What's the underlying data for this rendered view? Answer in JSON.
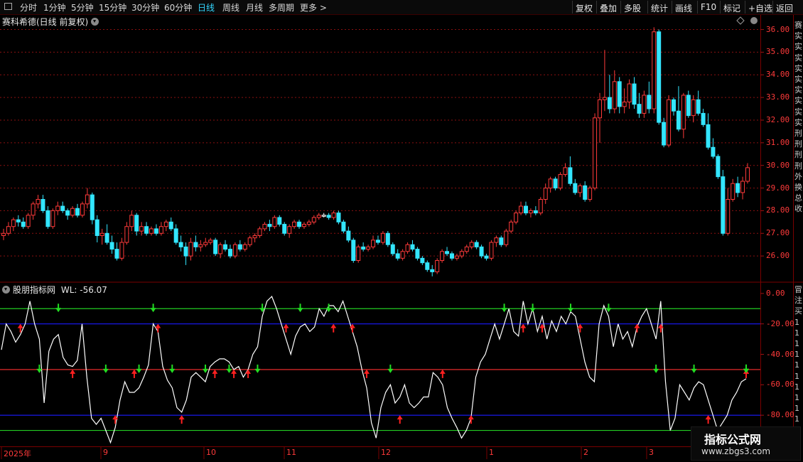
{
  "toolbar": {
    "periods": [
      "分时",
      "1分钟",
      "5分钟",
      "15分钟",
      "30分钟",
      "60分钟",
      "日线",
      "周线",
      "月线",
      "多周期",
      "更多 >"
    ],
    "active_period": "日线",
    "right_buttons": [
      "复权",
      "叠加",
      "多股",
      "统计",
      "画线",
      "F10",
      "标记",
      "+自选",
      "返回"
    ]
  },
  "stock": {
    "title": "赛科希德(日线 前复权)"
  },
  "indicator": {
    "name": "股朋指标网",
    "readout": "WL: -56.07"
  },
  "price_axis": {
    "labels": [
      "36.00",
      "35.00",
      "34.00",
      "33.00",
      "32.00",
      "31.00",
      "30.00",
      "29.00",
      "28.00",
      "27.00",
      "26.00"
    ]
  },
  "indicator_axis": {
    "labels": [
      "0.00",
      "-20.00",
      "-40.00",
      "-60.00",
      "-80.00"
    ]
  },
  "date_axis": {
    "labels": [
      "2025年",
      "9",
      "10",
      "11",
      "12",
      "1",
      "2",
      "3"
    ]
  },
  "right_edge_text": "赛\n实\n实\n实\n实\n实\n实\n实\n实\n实\n刑\n刑\n刑\n刑\n外\n换\n总\n收",
  "right_edge_text2": "冒\n注\n买\n1\n1\n1\n1\n1\n1\n1\n1\n1\n1\n1",
  "watermark": {
    "line1": "指标公式网",
    "line2": "www.zbgs3.com"
  },
  "colors": {
    "up": "#ff3a3a",
    "down": "#33e6ff",
    "flat": "#ffffff",
    "line": "#ffffff",
    "green_level": "#22cc22",
    "blue_level": "#1a1aff",
    "red_level": "#ff3030"
  },
  "chart_data": [
    {
      "type": "candlestick",
      "title": "赛科希德(日线 前复权)",
      "ylim": [
        25.0,
        36.3
      ],
      "yticks": [
        26,
        27,
        28,
        29,
        30,
        31,
        32,
        33,
        34,
        35,
        36
      ],
      "x_periods": [
        "2025年",
        "9",
        "10",
        "11",
        "12",
        "1",
        "2",
        "3"
      ],
      "candles": [
        [
          26.9,
          27.2,
          26.7,
          27.0
        ],
        [
          27.0,
          27.5,
          26.9,
          27.3
        ],
        [
          27.3,
          27.7,
          27.1,
          27.6
        ],
        [
          27.6,
          27.8,
          27.3,
          27.5
        ],
        [
          27.5,
          27.7,
          27.2,
          27.3
        ],
        [
          27.3,
          27.9,
          27.2,
          27.8
        ],
        [
          27.8,
          28.4,
          27.6,
          28.3
        ],
        [
          28.3,
          28.7,
          28.1,
          28.5
        ],
        [
          28.5,
          28.7,
          27.9,
          28.0
        ],
        [
          28.0,
          28.2,
          27.2,
          27.3
        ],
        [
          27.3,
          28.1,
          27.2,
          28.0
        ],
        [
          28.0,
          28.4,
          27.8,
          28.2
        ],
        [
          28.2,
          28.4,
          27.9,
          28.0
        ],
        [
          28.0,
          28.1,
          27.6,
          27.8
        ],
        [
          27.8,
          28.2,
          27.7,
          28.1
        ],
        [
          28.1,
          28.3,
          27.7,
          27.8
        ],
        [
          27.8,
          28.4,
          27.7,
          28.3
        ],
        [
          28.3,
          29.0,
          28.1,
          28.7
        ],
        [
          28.7,
          28.8,
          27.4,
          27.6
        ],
        [
          27.6,
          27.8,
          26.6,
          26.9
        ],
        [
          26.9,
          27.2,
          26.5,
          27.0
        ],
        [
          27.0,
          27.4,
          26.5,
          26.6
        ],
        [
          26.6,
          26.9,
          26.1,
          26.3
        ],
        [
          26.3,
          26.6,
          25.8,
          25.9
        ],
        [
          25.9,
          26.8,
          25.8,
          26.6
        ],
        [
          26.6,
          27.5,
          26.5,
          27.3
        ],
        [
          27.3,
          28.0,
          27.1,
          27.8
        ],
        [
          27.8,
          27.9,
          26.9,
          27.1
        ],
        [
          27.1,
          27.5,
          26.9,
          27.3
        ],
        [
          27.3,
          27.5,
          26.9,
          27.0
        ],
        [
          27.0,
          27.3,
          26.9,
          27.2
        ],
        [
          27.2,
          27.4,
          26.9,
          27.0
        ],
        [
          27.0,
          27.5,
          26.9,
          27.3
        ],
        [
          27.3,
          27.6,
          27.1,
          27.5
        ],
        [
          27.5,
          27.7,
          27.1,
          27.2
        ],
        [
          27.2,
          27.4,
          26.5,
          26.6
        ],
        [
          26.6,
          26.9,
          26.2,
          26.4
        ],
        [
          26.4,
          26.6,
          25.6,
          26.0
        ],
        [
          26.0,
          26.8,
          25.8,
          26.6
        ],
        [
          26.6,
          26.9,
          26.2,
          26.4
        ],
        [
          26.4,
          26.7,
          26.2,
          26.5
        ],
        [
          26.5,
          26.8,
          26.4,
          26.6
        ],
        [
          26.6,
          26.8,
          26.5,
          26.7
        ],
        [
          26.7,
          26.8,
          26.0,
          26.1
        ],
        [
          26.1,
          26.6,
          25.9,
          26.5
        ],
        [
          26.5,
          26.7,
          26.2,
          26.3
        ],
        [
          26.3,
          26.5,
          25.9,
          26.0
        ],
        [
          26.0,
          26.6,
          25.9,
          26.5
        ],
        [
          26.5,
          26.7,
          26.2,
          26.3
        ],
        [
          26.3,
          26.6,
          26.2,
          26.5
        ],
        [
          26.5,
          26.9,
          26.4,
          26.8
        ],
        [
          26.8,
          27.0,
          26.6,
          26.9
        ],
        [
          26.9,
          27.3,
          26.8,
          27.2
        ],
        [
          27.2,
          27.5,
          27.1,
          27.4
        ],
        [
          27.4,
          27.6,
          27.1,
          27.3
        ],
        [
          27.3,
          27.8,
          27.2,
          27.7
        ],
        [
          27.7,
          27.8,
          27.3,
          27.4
        ],
        [
          27.4,
          27.5,
          26.9,
          27.0
        ],
        [
          27.0,
          27.4,
          26.8,
          27.3
        ],
        [
          27.3,
          27.6,
          27.2,
          27.5
        ],
        [
          27.5,
          27.6,
          27.2,
          27.3
        ],
        [
          27.3,
          27.5,
          27.2,
          27.4
        ],
        [
          27.4,
          27.6,
          27.3,
          27.5
        ],
        [
          27.5,
          27.8,
          27.4,
          27.7
        ],
        [
          27.7,
          27.9,
          27.6,
          27.8
        ],
        [
          27.8,
          27.9,
          27.7,
          27.8
        ],
        [
          27.8,
          27.9,
          27.6,
          27.7
        ],
        [
          27.7,
          28.0,
          27.6,
          27.9
        ],
        [
          27.9,
          28.0,
          27.4,
          27.5
        ],
        [
          27.5,
          27.6,
          27.0,
          27.1
        ],
        [
          27.1,
          27.3,
          26.6,
          26.7
        ],
        [
          26.7,
          26.8,
          25.7,
          25.8
        ],
        [
          25.8,
          26.5,
          25.7,
          26.4
        ],
        [
          26.4,
          26.6,
          26.2,
          26.3
        ],
        [
          26.3,
          26.5,
          26.2,
          26.4
        ],
        [
          26.4,
          26.9,
          26.3,
          26.7
        ],
        [
          26.7,
          26.9,
          26.5,
          26.6
        ],
        [
          26.6,
          27.1,
          26.5,
          27.0
        ],
        [
          27.0,
          27.1,
          26.4,
          26.5
        ],
        [
          26.5,
          26.6,
          26.0,
          26.1
        ],
        [
          26.1,
          26.3,
          25.8,
          25.9
        ],
        [
          25.9,
          26.3,
          25.8,
          26.2
        ],
        [
          26.2,
          26.6,
          26.1,
          26.5
        ],
        [
          26.5,
          26.7,
          26.2,
          26.3
        ],
        [
          26.3,
          26.4,
          25.8,
          25.9
        ],
        [
          25.9,
          26.0,
          25.6,
          25.7
        ],
        [
          25.7,
          25.8,
          25.3,
          25.4
        ],
        [
          25.4,
          25.6,
          25.1,
          25.3
        ],
        [
          25.3,
          25.9,
          25.2,
          25.8
        ],
        [
          25.8,
          26.3,
          25.7,
          26.2
        ],
        [
          26.2,
          26.4,
          26.0,
          26.1
        ],
        [
          26.1,
          26.2,
          25.8,
          25.9
        ],
        [
          25.9,
          26.1,
          25.8,
          26.0
        ],
        [
          26.0,
          26.3,
          25.9,
          26.2
        ],
        [
          26.2,
          26.5,
          26.1,
          26.4
        ],
        [
          26.4,
          26.7,
          26.3,
          26.6
        ],
        [
          26.6,
          26.7,
          26.3,
          26.4
        ],
        [
          26.4,
          26.5,
          25.9,
          26.0
        ],
        [
          26.0,
          26.1,
          25.8,
          25.9
        ],
        [
          25.9,
          26.7,
          25.8,
          26.6
        ],
        [
          26.6,
          26.9,
          26.4,
          26.8
        ],
        [
          26.8,
          26.9,
          26.4,
          26.5
        ],
        [
          26.5,
          27.2,
          26.4,
          27.1
        ],
        [
          27.1,
          27.6,
          27.0,
          27.5
        ],
        [
          27.5,
          28.0,
          27.4,
          27.9
        ],
        [
          27.9,
          28.4,
          27.8,
          28.2
        ],
        [
          28.2,
          28.4,
          27.8,
          27.9
        ],
        [
          27.9,
          28.1,
          27.7,
          28.0
        ],
        [
          28.0,
          28.2,
          27.8,
          27.9
        ],
        [
          27.9,
          28.6,
          27.8,
          28.5
        ],
        [
          28.5,
          29.2,
          28.3,
          29.0
        ],
        [
          29.0,
          29.5,
          28.8,
          29.4
        ],
        [
          29.4,
          29.5,
          28.9,
          29.0
        ],
        [
          29.0,
          29.7,
          28.9,
          29.6
        ],
        [
          29.6,
          30.1,
          29.5,
          29.9
        ],
        [
          29.9,
          30.4,
          29.1,
          29.2
        ],
        [
          29.2,
          29.4,
          28.7,
          28.8
        ],
        [
          28.8,
          29.2,
          28.6,
          29.1
        ],
        [
          29.1,
          29.3,
          28.4,
          28.5
        ],
        [
          28.5,
          29.1,
          28.4,
          29.0
        ],
        [
          29.0,
          32.3,
          28.9,
          32.1
        ],
        [
          32.1,
          33.2,
          31.0,
          32.9
        ],
        [
          32.9,
          35.1,
          32.4,
          33.0
        ],
        [
          33.0,
          34.0,
          32.3,
          32.5
        ],
        [
          32.5,
          34.2,
          32.3,
          33.7
        ],
        [
          33.7,
          33.9,
          32.3,
          32.6
        ],
        [
          32.6,
          33.4,
          32.3,
          32.8
        ],
        [
          32.8,
          33.8,
          32.5,
          33.6
        ],
        [
          33.6,
          33.9,
          32.5,
          32.7
        ],
        [
          32.7,
          33.2,
          32.1,
          32.3
        ],
        [
          32.3,
          33.3,
          32.1,
          33.1
        ],
        [
          33.1,
          33.7,
          32.3,
          32.5
        ],
        [
          32.5,
          36.1,
          32.3,
          35.9
        ],
        [
          35.9,
          36.0,
          31.8,
          31.9
        ],
        [
          31.9,
          32.1,
          30.8,
          30.9
        ],
        [
          30.9,
          33.1,
          30.8,
          32.9
        ],
        [
          32.9,
          33.0,
          32.2,
          32.4
        ],
        [
          32.4,
          33.5,
          31.5,
          31.6
        ],
        [
          31.6,
          33.2,
          31.2,
          33.1
        ],
        [
          33.1,
          33.3,
          32.1,
          32.2
        ],
        [
          32.2,
          33.1,
          31.9,
          32.9
        ],
        [
          32.9,
          33.3,
          32.2,
          32.3
        ],
        [
          32.3,
          32.5,
          31.7,
          31.8
        ],
        [
          31.8,
          32.3,
          30.7,
          30.8
        ],
        [
          30.8,
          31.2,
          30.3,
          30.4
        ],
        [
          30.4,
          30.5,
          29.4,
          29.5
        ],
        [
          29.5,
          29.8,
          26.9,
          27.0
        ],
        [
          27.0,
          29.0,
          26.9,
          28.5
        ],
        [
          28.5,
          29.4,
          28.4,
          29.2
        ],
        [
          29.2,
          29.5,
          28.6,
          28.8
        ],
        [
          28.8,
          29.5,
          28.5,
          29.3
        ],
        [
          29.3,
          30.1,
          29.2,
          29.9
        ]
      ]
    },
    {
      "type": "line",
      "series": [
        {
          "name": "WL",
          "last_value": -56.07
        }
      ],
      "ylim": [
        -100,
        6
      ],
      "yticks": [
        0,
        -20,
        -40,
        -60,
        -80
      ],
      "levels": [
        -10,
        -20,
        -50,
        -80,
        -90
      ],
      "values": [
        -37,
        -20,
        -25,
        -32,
        -27,
        -20,
        -5,
        -20,
        -30,
        -72,
        -38,
        -30,
        -27,
        -42,
        -47,
        -48,
        -44,
        -20,
        -55,
        -82,
        -86,
        -82,
        -90,
        -98,
        -88,
        -70,
        -58,
        -65,
        -65,
        -62,
        -55,
        -47,
        -20,
        -25,
        -48,
        -57,
        -62,
        -75,
        -78,
        -70,
        -55,
        -52,
        -55,
        -58,
        -48,
        -45,
        -43,
        -43,
        -45,
        -50,
        -48,
        -55,
        -50,
        -40,
        -35,
        -15,
        -5,
        -2,
        -10,
        -20,
        -30,
        -40,
        -28,
        -22,
        -20,
        -25,
        -22,
        -10,
        -15,
        -8,
        -8,
        -12,
        -5,
        -15,
        -25,
        -35,
        -50,
        -62,
        -85,
        -95,
        -75,
        -65,
        -60,
        -72,
        -68,
        -60,
        -72,
        -75,
        -72,
        -68,
        -68,
        -52,
        -55,
        -60,
        -75,
        -82,
        -88,
        -95,
        -90,
        -82,
        -55,
        -45,
        -40,
        -30,
        -20,
        -30,
        -20,
        -10,
        -25,
        -28,
        -5,
        -20,
        -10,
        -25,
        -15,
        -30,
        -18,
        -25,
        -15,
        -20,
        -12,
        -15,
        -30,
        -45,
        -55,
        -58,
        -20,
        -8,
        -15,
        -35,
        -20,
        -30,
        -25,
        -35,
        -22,
        -15,
        -10,
        -20,
        -30,
        -5,
        -58,
        -90,
        -82,
        -60,
        -65,
        -70,
        -62,
        -58,
        -60,
        -70,
        -80,
        -90,
        -85,
        -80,
        -70,
        -65,
        -58,
        -56.07
      ],
      "up_arrows": [
        4,
        14,
        23,
        27,
        32,
        37,
        43,
        47,
        50,
        58,
        67,
        71,
        74,
        81,
        89,
        95,
        106,
        110,
        117,
        129,
        134,
        143,
        152,
        154,
        159,
        167
      ],
      "down_arrows": [
        8,
        12,
        21,
        28,
        31,
        35,
        41,
        46,
        52,
        53,
        61,
        66,
        79,
        102,
        108,
        115,
        123,
        133,
        140,
        151,
        160,
        164,
        171
      ]
    }
  ]
}
